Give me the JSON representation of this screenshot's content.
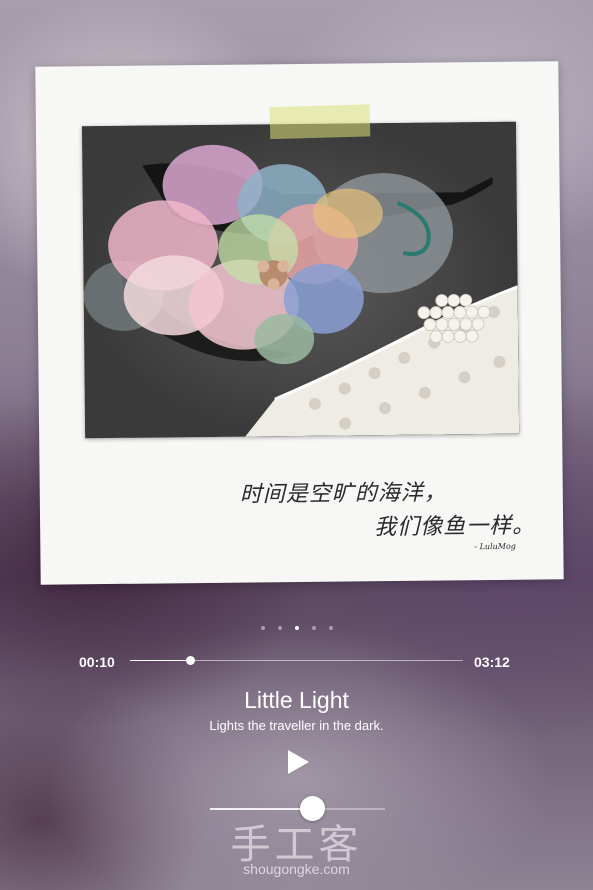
{
  "photo_card": {
    "handwriting_line1": "时间是空旷的海洋，",
    "handwriting_line2": "我们像鱼一样。",
    "signature": "- LuluMog",
    "photo_subject": "handmade organza flower hair clip with lace and pearls"
  },
  "pager": {
    "count": 5,
    "active_index": 2
  },
  "player": {
    "current_time": "00:10",
    "total_time": "03:12",
    "progress_fraction": 0.18,
    "song_title": "Little Light",
    "song_subtitle": "Lights the traveller in the dark.",
    "play_icon": "play-icon",
    "volume_fraction": 0.58
  },
  "watermark": {
    "chinese": "手工客",
    "domain": "shougongke.com"
  },
  "colors": {
    "text": "#ffffff",
    "card": "#f7f7f5",
    "tape": "#dce278"
  }
}
